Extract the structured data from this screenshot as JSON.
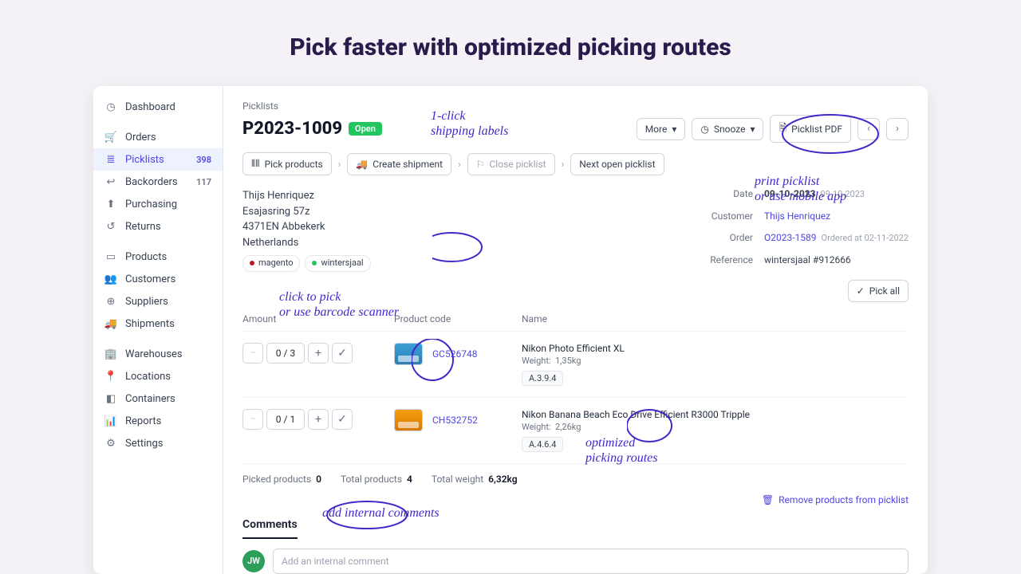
{
  "headline": "Pick faster with optimized picking routes",
  "sidebar": {
    "items": [
      {
        "label": "Dashboard",
        "icon": "gauge"
      },
      {
        "label": "Orders",
        "icon": "cart"
      },
      {
        "label": "Picklists",
        "icon": "list",
        "badge": "398",
        "active": true
      },
      {
        "label": "Backorders",
        "icon": "back",
        "badge": "117",
        "gray": true
      },
      {
        "label": "Purchasing",
        "icon": "up"
      },
      {
        "label": "Returns",
        "icon": "return"
      },
      {
        "label": "Products",
        "icon": "box"
      },
      {
        "label": "Customers",
        "icon": "users"
      },
      {
        "label": "Suppliers",
        "icon": "globe"
      },
      {
        "label": "Shipments",
        "icon": "truck"
      },
      {
        "label": "Warehouses",
        "icon": "building"
      },
      {
        "label": "Locations",
        "icon": "pin"
      },
      {
        "label": "Containers",
        "icon": "cube"
      },
      {
        "label": "Reports",
        "icon": "chart"
      },
      {
        "label": "Settings",
        "icon": "gear"
      }
    ]
  },
  "breadcrumb": "Picklists",
  "picklist": {
    "number": "P2023-1009",
    "status": "Open"
  },
  "title_actions": {
    "more": "More",
    "snooze": "Snooze",
    "pdf": "Picklist PDF"
  },
  "steps": {
    "pick": "Pick products",
    "create": "Create shipment",
    "close": "Close picklist",
    "next": "Next open picklist"
  },
  "address": {
    "name": "Thijs Henriquez",
    "line1": "Esajasring 57z",
    "line2": "4371EN Abbekerk",
    "country": "Netherlands"
  },
  "tags": [
    "magento",
    "wintersjaal"
  ],
  "tag_colors": [
    "#b91c1c",
    "#22c55e"
  ],
  "meta": {
    "date_label": "Date",
    "date": "09-10-2023",
    "date_sub": "09-10-2023",
    "customer_label": "Customer",
    "customer": "Thijs Henriquez",
    "order_label": "Order",
    "order": "O2023-1589",
    "order_sub": "Ordered at 02-11-2022",
    "reference_label": "Reference",
    "reference": "wintersjaal #912666"
  },
  "pick_all": "Pick all",
  "columns": {
    "amount": "Amount",
    "code": "Product code",
    "name": "Name"
  },
  "rows": [
    {
      "qty": "0 / 3",
      "code": "GC526748",
      "name": "Nikon Photo Efficient XL",
      "weight_label": "Weight:",
      "weight": "1,35kg",
      "loc": "A.3.9.4",
      "thumb": "blue"
    },
    {
      "qty": "0 / 1",
      "code": "CH532752",
      "name": "Nikon Banana Beach Eco Drive Efficient R3000 Tripple",
      "weight_label": "Weight:",
      "weight": "2,26kg",
      "loc": "A.4.6.4",
      "thumb": "orange"
    }
  ],
  "totals": {
    "picked_label": "Picked products",
    "picked": "0",
    "total_label": "Total products",
    "total": "4",
    "weight_label": "Total weight",
    "weight": "6,32kg"
  },
  "remove_link": "Remove products from picklist",
  "comments": {
    "tab": "Comments",
    "avatar": "JW",
    "placeholder": "Add an internal comment"
  },
  "annotations": {
    "ship": "1-click\nshipping labels",
    "pdf": "print picklist\nor use mobile app",
    "pick": "click to pick\nor use barcode scanner",
    "routes": "optimized\npicking routes",
    "comments": "add internal comments"
  }
}
